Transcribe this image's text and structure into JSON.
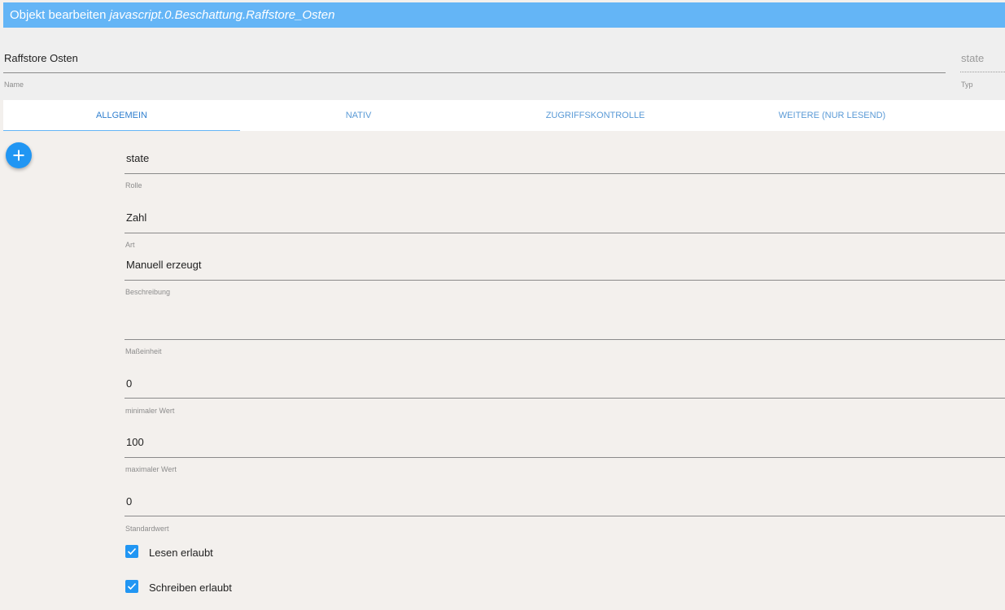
{
  "dialog": {
    "title_prefix": "Objekt bearbeiten",
    "object_path": "javascript.0.Beschattung.Raffstore_Osten"
  },
  "header": {
    "name_value": "Raffstore Osten",
    "name_label": "Name",
    "type_value": "state",
    "type_label": "Typ"
  },
  "tabs": [
    {
      "label": "Allgemein",
      "active": true
    },
    {
      "label": "Nativ",
      "active": false
    },
    {
      "label": "Zugriffskontrolle",
      "active": false
    },
    {
      "label": "Weitere (nur lesend)",
      "active": false
    }
  ],
  "add_button": {
    "icon": "plus-icon"
  },
  "fields": {
    "role": {
      "value": "state",
      "label": "Rolle"
    },
    "kind": {
      "value": "Zahl",
      "label": "Art"
    },
    "description": {
      "value": "Manuell erzeugt",
      "label": "Beschreibung"
    },
    "unit": {
      "value": "",
      "label": "Maßeinheit"
    },
    "min": {
      "value": "0",
      "label": "minimaler Wert"
    },
    "max": {
      "value": "100",
      "label": "maximaler Wert"
    },
    "default": {
      "value": "0",
      "label": "Standardwert"
    }
  },
  "checkboxes": {
    "read": {
      "label": "Lesen erlaubt",
      "checked": true
    },
    "write": {
      "label": "Schreiben erlaubt",
      "checked": true
    }
  },
  "colors": {
    "accent": "#2196f3",
    "titlebar": "#64b5f6",
    "background": "#f3f0ed"
  }
}
